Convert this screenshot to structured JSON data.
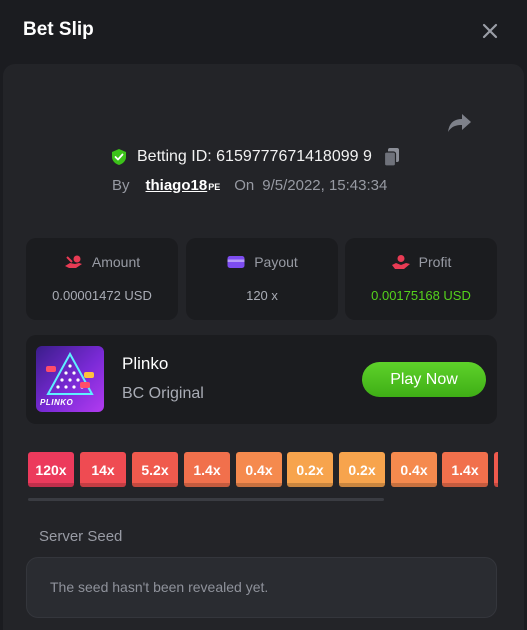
{
  "window": {
    "title": "Bet Slip"
  },
  "bet": {
    "id_label": "Betting ID: 6159777671418099 9",
    "by_label": "By",
    "username": "thiago18",
    "user_badge": "PE",
    "on_label": "On",
    "datetime": "9/5/2022, 15:43:34"
  },
  "stats": [
    {
      "label": "Amount",
      "value": "0.00001472 USD",
      "icon": "coins-hand-icon",
      "color": "#e83b54"
    },
    {
      "label": "Payout",
      "value": "120 x",
      "icon": "card-icon",
      "color": "#7d4cf0"
    },
    {
      "label": "Profit",
      "value": "0.00175168 USD",
      "icon": "hand-coin-icon",
      "color": "#e83b54"
    }
  ],
  "game": {
    "name": "Plinko",
    "subtitle": "BC Original",
    "thumb_label": "PLINKO",
    "play_label": "Play Now"
  },
  "multipliers": [
    {
      "label": "120x",
      "color": "#ec3a5c"
    },
    {
      "label": "14x",
      "color": "#ef4b52"
    },
    {
      "label": "5.2x",
      "color": "#f05a4d"
    },
    {
      "label": "1.4x",
      "color": "#f1704c"
    },
    {
      "label": "0.4x",
      "color": "#f58a4e"
    },
    {
      "label": "0.2x",
      "color": "#f7a44d"
    },
    {
      "label": "0.2x",
      "color": "#f7a44d"
    },
    {
      "label": "0.4x",
      "color": "#f58a4e"
    },
    {
      "label": "1.4x",
      "color": "#f1704c"
    },
    {
      "label": "",
      "color": "#f05a4d"
    }
  ],
  "seed": {
    "label": "Server Seed",
    "placeholder": "The seed hasn't been revealed yet."
  },
  "colors": {
    "accent_green": "#54d21c",
    "background": "#1b1c20",
    "panel": "#232428"
  }
}
